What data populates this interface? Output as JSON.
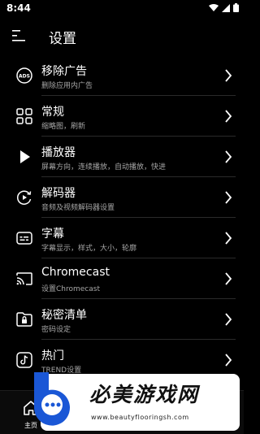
{
  "status_bar": {
    "time": "8:44"
  },
  "header": {
    "title": "设置"
  },
  "settings": [
    {
      "icon": "ads-icon",
      "title": "移除广告",
      "subtitle": "删除应用内广告"
    },
    {
      "icon": "grid-icon",
      "title": "常规",
      "subtitle": "缩略图，刷新"
    },
    {
      "icon": "play-icon",
      "title": "播放器",
      "subtitle": "屏幕方向，连续播放，自动播放，快进"
    },
    {
      "icon": "decoder-icon",
      "title": "解码器",
      "subtitle": "音频及视频解码器设置"
    },
    {
      "icon": "subtitles-icon",
      "title": "字幕",
      "subtitle": "字幕显示，样式，大小，轮廓"
    },
    {
      "icon": "cast-icon",
      "title": "Chromecast",
      "subtitle": "设置Chromecast"
    },
    {
      "icon": "locked-folder-icon",
      "title": "秘密清单",
      "subtitle": "密码设定"
    },
    {
      "icon": "tiktok-icon",
      "title": "热门",
      "subtitle": "TREND设置"
    }
  ],
  "bottom_nav": {
    "home_label": "主页"
  },
  "watermark": {
    "title": "必美游戏网",
    "url": "www.beautyflooringsh.com"
  }
}
